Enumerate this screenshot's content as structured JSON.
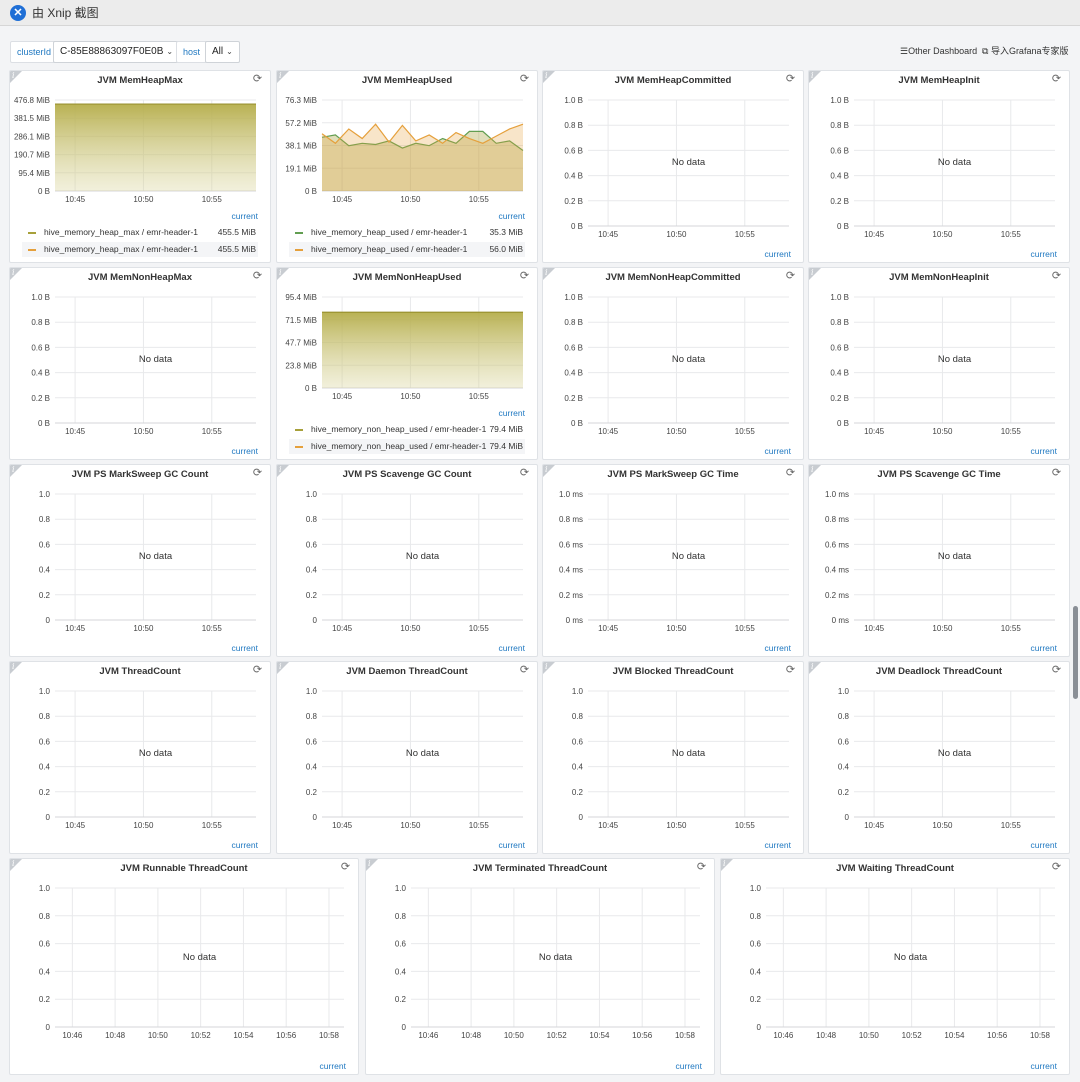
{
  "window": {
    "title": "由 Xnip 截图",
    "app_icon": "xnip-icon"
  },
  "toolbar": {
    "cluster_label": "clusterId",
    "cluster_value": "C-85E88863097F0E0B",
    "host_label": "host",
    "host_value": "All",
    "other_dashboard": "Other Dashboard",
    "import_grafana": "导入Grafana专家版"
  },
  "no_data_text": "No data",
  "legend_link": "current",
  "colors": {
    "olive": "#a7a03a",
    "green": "#629e51",
    "orange": "#e5a03c",
    "accent": "#1f78c1"
  },
  "panels": [
    {
      "title": "JVM MemHeapMax",
      "y_ticks": [
        "476.8 MiB",
        "381.5 MiB",
        "286.1 MiB",
        "190.7 MiB",
        "95.4 MiB",
        "0 B"
      ],
      "x_ticks": [
        "10:45",
        "10:50",
        "10:55"
      ],
      "has_data": true,
      "legend": [
        {
          "name": "hive_memory_heap_max / emr-header-1",
          "value": "455.5 MiB",
          "color": "olive"
        },
        {
          "name": "hive_memory_heap_max / emr-header-1",
          "value": "455.5 MiB",
          "color": "orange"
        }
      ]
    },
    {
      "title": "JVM MemHeapUsed",
      "y_ticks": [
        "76.3 MiB",
        "57.2 MiB",
        "38.1 MiB",
        "19.1 MiB",
        "0 B"
      ],
      "x_ticks": [
        "10:45",
        "10:50",
        "10:55"
      ],
      "has_data": true,
      "legend": [
        {
          "name": "hive_memory_heap_used / emr-header-1",
          "value": "35.3 MiB",
          "color": "green"
        },
        {
          "name": "hive_memory_heap_used / emr-header-1",
          "value": "56.0 MiB",
          "color": "orange"
        }
      ]
    },
    {
      "title": "JVM MemHeapCommitted",
      "y_ticks": [
        "1.0 B",
        "0.8 B",
        "0.6 B",
        "0.4 B",
        "0.2 B",
        "0 B"
      ],
      "x_ticks": [
        "10:45",
        "10:50",
        "10:55"
      ],
      "has_data": false
    },
    {
      "title": "JVM MemHeapInit",
      "y_ticks": [
        "1.0 B",
        "0.8 B",
        "0.6 B",
        "0.4 B",
        "0.2 B",
        "0 B"
      ],
      "x_ticks": [
        "10:45",
        "10:50",
        "10:55"
      ],
      "has_data": false
    },
    {
      "title": "JVM MemNonHeapMax",
      "y_ticks": [
        "1.0 B",
        "0.8 B",
        "0.6 B",
        "0.4 B",
        "0.2 B",
        "0 B"
      ],
      "x_ticks": [
        "10:45",
        "10:50",
        "10:55"
      ],
      "has_data": false
    },
    {
      "title": "JVM MemNonHeapUsed",
      "y_ticks": [
        "95.4 MiB",
        "71.5 MiB",
        "47.7 MiB",
        "23.8 MiB",
        "0 B"
      ],
      "x_ticks": [
        "10:45",
        "10:50",
        "10:55"
      ],
      "has_data": true,
      "legend": [
        {
          "name": "hive_memory_non_heap_used / emr-header-1",
          "value": "79.4 MiB",
          "color": "olive"
        },
        {
          "name": "hive_memory_non_heap_used / emr-header-1",
          "value": "79.4 MiB",
          "color": "orange"
        }
      ]
    },
    {
      "title": "JVM MemNonHeapCommitted",
      "y_ticks": [
        "1.0 B",
        "0.8 B",
        "0.6 B",
        "0.4 B",
        "0.2 B",
        "0 B"
      ],
      "x_ticks": [
        "10:45",
        "10:50",
        "10:55"
      ],
      "has_data": false
    },
    {
      "title": "JVM MemNonHeapInit",
      "y_ticks": [
        "1.0 B",
        "0.8 B",
        "0.6 B",
        "0.4 B",
        "0.2 B",
        "0 B"
      ],
      "x_ticks": [
        "10:45",
        "10:50",
        "10:55"
      ],
      "has_data": false
    },
    {
      "title": "JVM PS MarkSweep GC Count",
      "y_ticks": [
        "1.0",
        "0.8",
        "0.6",
        "0.4",
        "0.2",
        "0"
      ],
      "x_ticks": [
        "10:45",
        "10:50",
        "10:55"
      ],
      "has_data": false
    },
    {
      "title": "JVM PS Scavenge GC Count",
      "y_ticks": [
        "1.0",
        "0.8",
        "0.6",
        "0.4",
        "0.2",
        "0"
      ],
      "x_ticks": [
        "10:45",
        "10:50",
        "10:55"
      ],
      "has_data": false
    },
    {
      "title": "JVM PS MarkSweep GC Time",
      "y_ticks": [
        "1.0 ms",
        "0.8 ms",
        "0.6 ms",
        "0.4 ms",
        "0.2 ms",
        "0 ms"
      ],
      "x_ticks": [
        "10:45",
        "10:50",
        "10:55"
      ],
      "has_data": false
    },
    {
      "title": "JVM PS Scavenge GC Time",
      "y_ticks": [
        "1.0 ms",
        "0.8 ms",
        "0.6 ms",
        "0.4 ms",
        "0.2 ms",
        "0 ms"
      ],
      "x_ticks": [
        "10:45",
        "10:50",
        "10:55"
      ],
      "has_data": false
    },
    {
      "title": "JVM ThreadCount",
      "y_ticks": [
        "1.0",
        "0.8",
        "0.6",
        "0.4",
        "0.2",
        "0"
      ],
      "x_ticks": [
        "10:45",
        "10:50",
        "10:55"
      ],
      "has_data": false
    },
    {
      "title": "JVM Daemon ThreadCount",
      "y_ticks": [
        "1.0",
        "0.8",
        "0.6",
        "0.4",
        "0.2",
        "0"
      ],
      "x_ticks": [
        "10:45",
        "10:50",
        "10:55"
      ],
      "has_data": false
    },
    {
      "title": "JVM Blocked ThreadCount",
      "y_ticks": [
        "1.0",
        "0.8",
        "0.6",
        "0.4",
        "0.2",
        "0"
      ],
      "x_ticks": [
        "10:45",
        "10:50",
        "10:55"
      ],
      "has_data": false
    },
    {
      "title": "JVM Deadlock ThreadCount",
      "y_ticks": [
        "1.0",
        "0.8",
        "0.6",
        "0.4",
        "0.2",
        "0"
      ],
      "x_ticks": [
        "10:45",
        "10:50",
        "10:55"
      ],
      "has_data": false
    },
    {
      "title": "JVM Runnable ThreadCount",
      "y_ticks": [
        "1.0",
        "0.8",
        "0.6",
        "0.4",
        "0.2",
        "0"
      ],
      "x_ticks": [
        "10:46",
        "10:48",
        "10:50",
        "10:52",
        "10:54",
        "10:56",
        "10:58"
      ],
      "has_data": false
    },
    {
      "title": "JVM Terminated ThreadCount",
      "y_ticks": [
        "1.0",
        "0.8",
        "0.6",
        "0.4",
        "0.2",
        "0"
      ],
      "x_ticks": [
        "10:46",
        "10:48",
        "10:50",
        "10:52",
        "10:54",
        "10:56",
        "10:58"
      ],
      "has_data": false
    },
    {
      "title": "JVM Waiting ThreadCount",
      "y_ticks": [
        "1.0",
        "0.8",
        "0.6",
        "0.4",
        "0.2",
        "0"
      ],
      "x_ticks": [
        "10:46",
        "10:48",
        "10:50",
        "10:52",
        "10:54",
        "10:56",
        "10:58"
      ],
      "has_data": false
    }
  ],
  "chart_data": [
    {
      "type": "area",
      "title": "JVM MemHeapMax",
      "unit": "MiB",
      "ylim": [
        0,
        476.8
      ],
      "x_range": [
        "10:43",
        "10:58"
      ],
      "series": [
        {
          "name": "hive_memory_heap_max / emr-header-1",
          "x": [
            "10:43",
            "10:58"
          ],
          "values": [
            455.5,
            455.5
          ]
        }
      ]
    },
    {
      "type": "line",
      "title": "JVM MemHeapUsed",
      "unit": "MiB",
      "ylim": [
        0,
        76.3
      ],
      "x_range": [
        "10:43",
        "10:58"
      ],
      "series": [
        {
          "name": "hive_memory_heap_used / emr-header-1",
          "x": [
            "10:43",
            "10:44",
            "10:45",
            "10:46",
            "10:47",
            "10:48",
            "10:49",
            "10:50",
            "10:51",
            "10:52",
            "10:53",
            "10:54",
            "10:55",
            "10:56",
            "10:57",
            "10:58"
          ],
          "values": [
            45,
            47,
            38,
            40,
            39,
            42,
            36,
            40,
            38,
            44,
            40,
            50,
            50,
            40,
            42,
            34
          ]
        },
        {
          "name": "hive_memory_heap_used / emr-header-1",
          "x": [
            "10:43",
            "10:44",
            "10:45",
            "10:46",
            "10:47",
            "10:48",
            "10:49",
            "10:50",
            "10:51",
            "10:52",
            "10:53",
            "10:54",
            "10:55",
            "10:56",
            "10:57",
            "10:58"
          ],
          "values": [
            48,
            40,
            52,
            44,
            56,
            41,
            55,
            42,
            47,
            40,
            49,
            44,
            40,
            46,
            52,
            56
          ]
        }
      ]
    },
    {
      "type": "area",
      "title": "JVM MemNonHeapUsed",
      "unit": "MiB",
      "ylim": [
        0,
        95.4
      ],
      "x_range": [
        "10:43",
        "10:58"
      ],
      "series": [
        {
          "name": "hive_memory_non_heap_used / emr-header-1",
          "x": [
            "10:43",
            "10:58"
          ],
          "values": [
            79.4,
            79.4
          ]
        }
      ]
    }
  ]
}
